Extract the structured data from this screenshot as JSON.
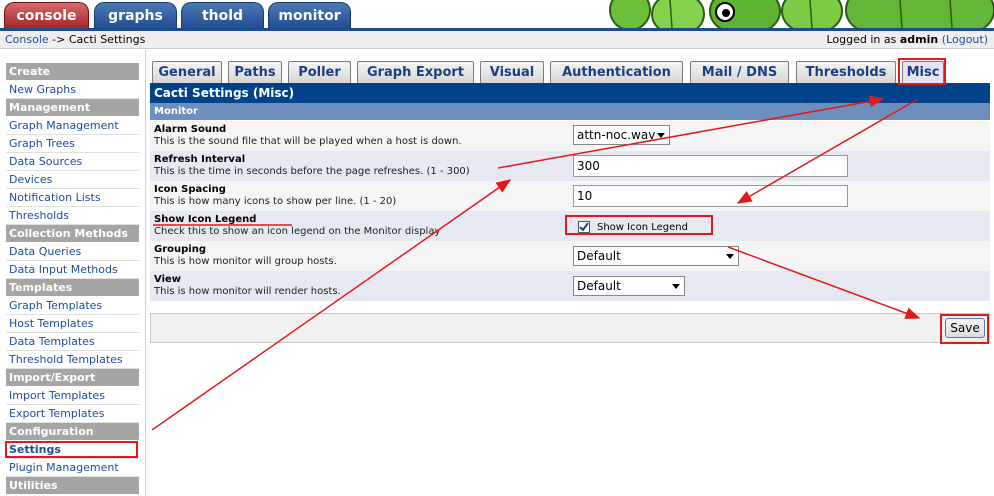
{
  "top_tabs": [
    {
      "label": "console",
      "active": true
    },
    {
      "label": "graphs",
      "active": false
    },
    {
      "label": "thold",
      "active": false
    },
    {
      "label": "monitor",
      "active": false
    }
  ],
  "breadcrumb": {
    "console": "Console",
    "separator": " -> ",
    "current": "Cacti Settings"
  },
  "login": {
    "prefix": "Logged in as ",
    "user": "admin",
    "logout": "(Logout)"
  },
  "sidebar": {
    "sections": [
      {
        "header": "Create",
        "items": [
          "New Graphs"
        ]
      },
      {
        "header": "Management",
        "items": [
          "Graph Management",
          "Graph Trees",
          "Data Sources",
          "Devices",
          "Notification Lists",
          "Thresholds"
        ]
      },
      {
        "header": "Collection Methods",
        "items": [
          "Data Queries",
          "Data Input Methods"
        ]
      },
      {
        "header": "Templates",
        "items": [
          "Graph Templates",
          "Host Templates",
          "Data Templates",
          "Threshold Templates"
        ]
      },
      {
        "header": "Import/Export",
        "items": [
          "Import Templates",
          "Export Templates"
        ]
      },
      {
        "header": "Configuration",
        "items": [
          "Settings",
          "Plugin Management"
        ]
      },
      {
        "header": "Utilities",
        "items": []
      }
    ],
    "active_item": "Settings"
  },
  "content_tabs": [
    "General",
    "Paths",
    "Poller",
    "Graph Export",
    "Visual",
    "Authentication",
    "Mail / DNS",
    "Thresholds",
    "Misc"
  ],
  "active_tab": "Misc",
  "panel_title": "Cacti Settings (Misc)",
  "section_title": "Monitor",
  "settings": [
    {
      "label": "Alarm Sound",
      "desc": "This is the sound file that will be played when a host is down.",
      "value": "attn-noc.wav"
    },
    {
      "label": "Refresh Interval",
      "desc": "This is the time in seconds before the page refreshes. (1 - 300)",
      "value": "300"
    },
    {
      "label": "Icon Spacing",
      "desc": "This is how many icons to show per line. (1 - 20)",
      "value": "10"
    },
    {
      "label": "Show Icon Legend",
      "desc": "Check this to show an icon legend on the Monitor display",
      "value": "Show Icon Legend",
      "checked": true
    },
    {
      "label": "Grouping",
      "desc": "This is how monitor will group hosts.",
      "value": "Default"
    },
    {
      "label": "View",
      "desc": "This is how monitor will render hosts.",
      "value": "Default"
    }
  ],
  "save_label": "Save",
  "colors": {
    "nav_blue": "#1d4b8f",
    "active_red": "#a32020",
    "annotation_red": "#e01a1a",
    "panel_header": "#00438c",
    "section_header": "#6d8fbd"
  }
}
